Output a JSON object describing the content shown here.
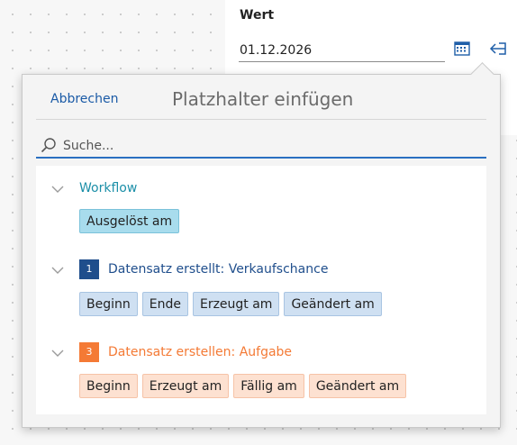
{
  "field": {
    "label": "Wert",
    "value": "01.12.2026",
    "calendar_icon": "calendar-icon",
    "insert_icon": "insert-placeholder-icon"
  },
  "popover": {
    "cancel_label": "Abbrechen",
    "title": "Platzhalter einfügen",
    "search_placeholder": "Suche...",
    "groups": [
      {
        "title": "Workflow",
        "title_color": "#1c8fa8",
        "chips": [
          "Ausgelöst am"
        ]
      },
      {
        "badge": "1",
        "badge_color": "#1f4e8c",
        "title": "Datensatz erstellt: Verkaufschance",
        "title_color": "#1f4e8c",
        "chips": [
          "Beginn",
          "Ende",
          "Erzeugt am",
          "Geändert am"
        ]
      },
      {
        "badge": "3",
        "badge_color": "#f47a35",
        "title": "Datensatz erstellen: Aufgabe",
        "title_color": "#f47a35",
        "chips": [
          "Beginn",
          "Erzeugt am",
          "Fällig am",
          "Geändert am"
        ]
      }
    ]
  }
}
